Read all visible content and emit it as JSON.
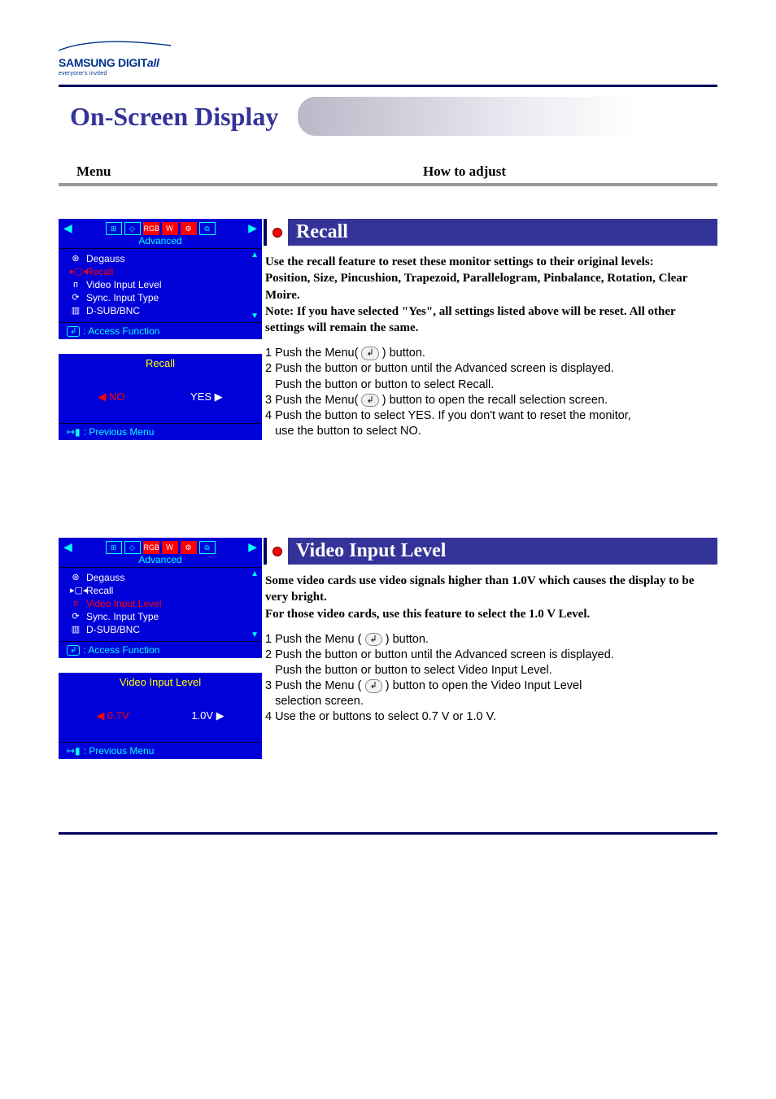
{
  "logo": {
    "brand": "SAMSUNG DIGIT",
    "brand_ital": "all",
    "tagline": "everyone's invited"
  },
  "page_title": "On-Screen Display",
  "headers": {
    "menu": "Menu",
    "how": "How to adjust"
  },
  "osd_common": {
    "advanced": "Advanced",
    "items": {
      "degauss": "Degauss",
      "recall": "Recall",
      "video_input_level": "Video Input Level",
      "sync_input_type": "Sync. Input Type",
      "dsub_bnc": "D-SUB/BNC"
    },
    "access_fn": ": Access Function",
    "prev_menu": ": Previous Menu"
  },
  "recall": {
    "title": "Recall",
    "sub_title": "Recall",
    "no": "NO",
    "yes": "YES",
    "desc_l1": "Use the recall feature to reset these monitor settings to their original levels:",
    "desc_l2": "Position, Size, Pincushion, Trapezoid, Parallelogram, Pinbalance, Rotation, Clear Moire.",
    "desc_l3": "Note: If you have selected \"Yes\", all settings listed above will be reset. All other settings will remain the same.",
    "step1": "Push the Menu(      ) button.",
    "step2a": "Push the      button or      button until the Advanced screen is displayed.",
    "step2b": "Push the      button or      button to select Recall.",
    "step3": "Push the Menu(      ) button to open the recall selection screen.",
    "step4a": "Push the      button to select YES. If you don't want to reset the monitor,",
    "step4b": "use the      button to select NO."
  },
  "vil": {
    "title": "Video Input Level",
    "sub_title": "Video Input Level",
    "opt_a": "0.7V",
    "opt_b": "1.0V",
    "desc_l1": "Some video cards use video signals higher than 1.0V which causes the display to be very bright.",
    "desc_l2": "For those video cards, use this feature to select the 1.0 V Level.",
    "step1": "Push the Menu (      ) button.",
    "step2a": "Push the      button or      button until the Advanced screen is displayed.",
    "step2b": "Push the      button or      button to select Video Input Level.",
    "step3a": "Push the Menu (      ) button to open the Video Input Level",
    "step3b": "selection screen.",
    "step4": "Use the      or      buttons to select 0.7 V or 1.0 V."
  }
}
